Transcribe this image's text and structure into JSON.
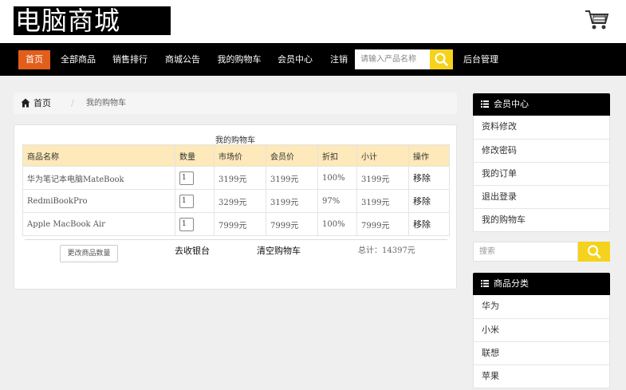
{
  "header": {
    "logo_text": "电脑商城",
    "cart_icon": "shopping-cart-icon"
  },
  "nav": {
    "items": [
      "首页",
      "全部商品",
      "销售排行",
      "商城公告",
      "我的购物车",
      "会员中心",
      "注销"
    ],
    "active_index": 0,
    "search_placeholder": "请输入产品名称",
    "search_icon": "search-icon",
    "admin_label": "后台管理",
    "active_color": "#e25e1b",
    "search_button_color": "#f5d21b"
  },
  "breadcrumb": {
    "home_icon": "home-icon",
    "home": "首页",
    "separator": "/",
    "current": "我的购物车"
  },
  "cart": {
    "title": "我的购物车",
    "columns": [
      "商品名称",
      "数量",
      "市场价",
      "会员价",
      "折扣",
      "小计",
      "操作"
    ],
    "rows": [
      {
        "name": "华为笔记本电脑MateBook",
        "qty": "1",
        "market_price": "3199元",
        "member_price": "3199元",
        "discount": "100%",
        "subtotal": "3199元",
        "action": "移除"
      },
      {
        "name": "RedmiBookPro",
        "qty": "1",
        "market_price": "3299元",
        "member_price": "3199元",
        "discount": "97%",
        "subtotal": "3199元",
        "action": "移除"
      },
      {
        "name": "Apple MacBook Air",
        "qty": "1",
        "market_price": "7999元",
        "member_price": "7999元",
        "discount": "100%",
        "subtotal": "7999元",
        "action": "移除"
      }
    ],
    "update_button": "更改商品数量",
    "checkout_button": "去收银台",
    "clear_button": "清空购物车",
    "total": "总计：14397元",
    "header_color": "#fde9b9"
  },
  "sidebar": {
    "member": {
      "title": "会员中心",
      "icon": "list-icon",
      "items": [
        "资料修改",
        "修改密码",
        "我的订单",
        "退出登录",
        "我的购物车"
      ]
    },
    "search": {
      "placeholder": "搜索",
      "icon": "search-icon"
    },
    "categories": {
      "title": "商品分类",
      "icon": "list-icon",
      "items": [
        "华为",
        "小米",
        "联想",
        "苹果"
      ]
    }
  }
}
